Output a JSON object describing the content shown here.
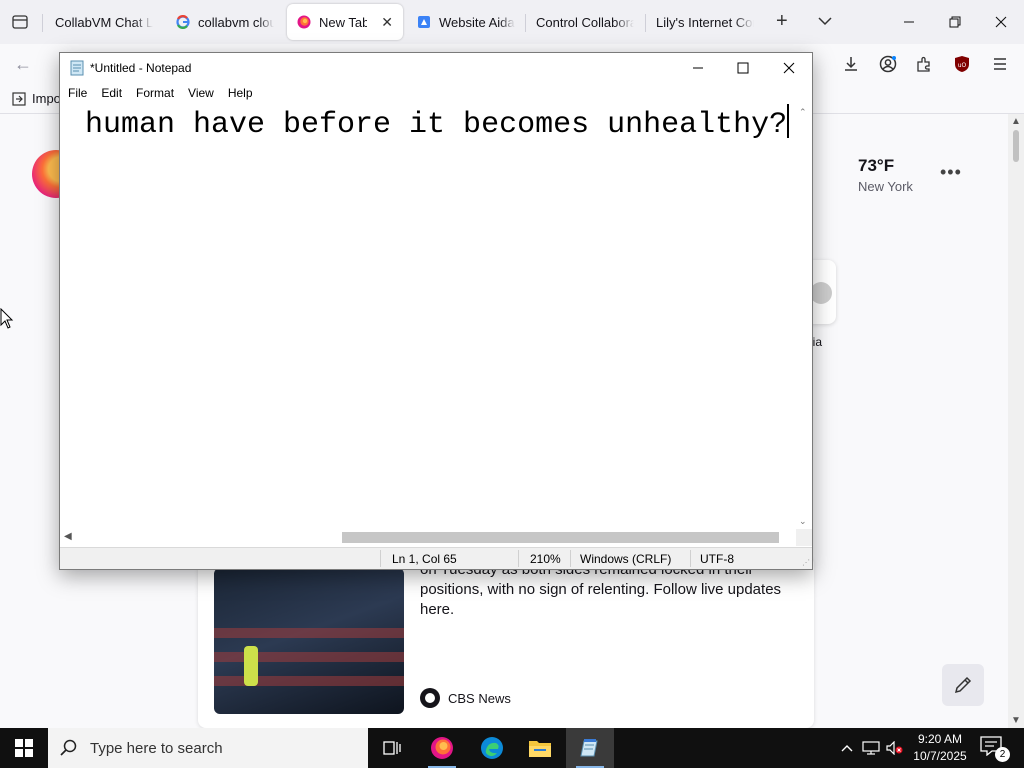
{
  "browser": {
    "tabs": [
      {
        "label": "CollabVM Chat Log",
        "active": false
      },
      {
        "label": "collabvm cloud",
        "active": false
      },
      {
        "label": "New Tab",
        "active": true
      },
      {
        "label": "Website Aidan",
        "active": false
      },
      {
        "label": "Control Collaborat",
        "active": false
      },
      {
        "label": "Lily's Internet Corn",
        "active": false
      }
    ],
    "bookmark_label": "Impo",
    "weather": {
      "temp": "73°F",
      "city": "New York"
    },
    "shortcut_label": "dia",
    "news": {
      "body": "on Tuesday as both sides remained locked in their positions, with no sign of relenting. Follow live updates here.",
      "source": "CBS News"
    }
  },
  "notepad": {
    "title": "*Untitled - Notepad",
    "menu": [
      "File",
      "Edit",
      "Format",
      "View",
      "Help"
    ],
    "text": "human have before it becomes unhealthy?",
    "status": {
      "position": "Ln 1, Col 65",
      "zoom": "210%",
      "line_ending": "Windows (CRLF)",
      "encoding": "UTF-8"
    }
  },
  "taskbar": {
    "search_placeholder": "Type here to search",
    "time": "9:20 AM",
    "date": "10/7/2025",
    "notification_count": "2"
  },
  "colors": {
    "firefox_tabbar": "#f0f0f4",
    "taskbar": "#101010",
    "active_indicator": "#88b7e8"
  }
}
